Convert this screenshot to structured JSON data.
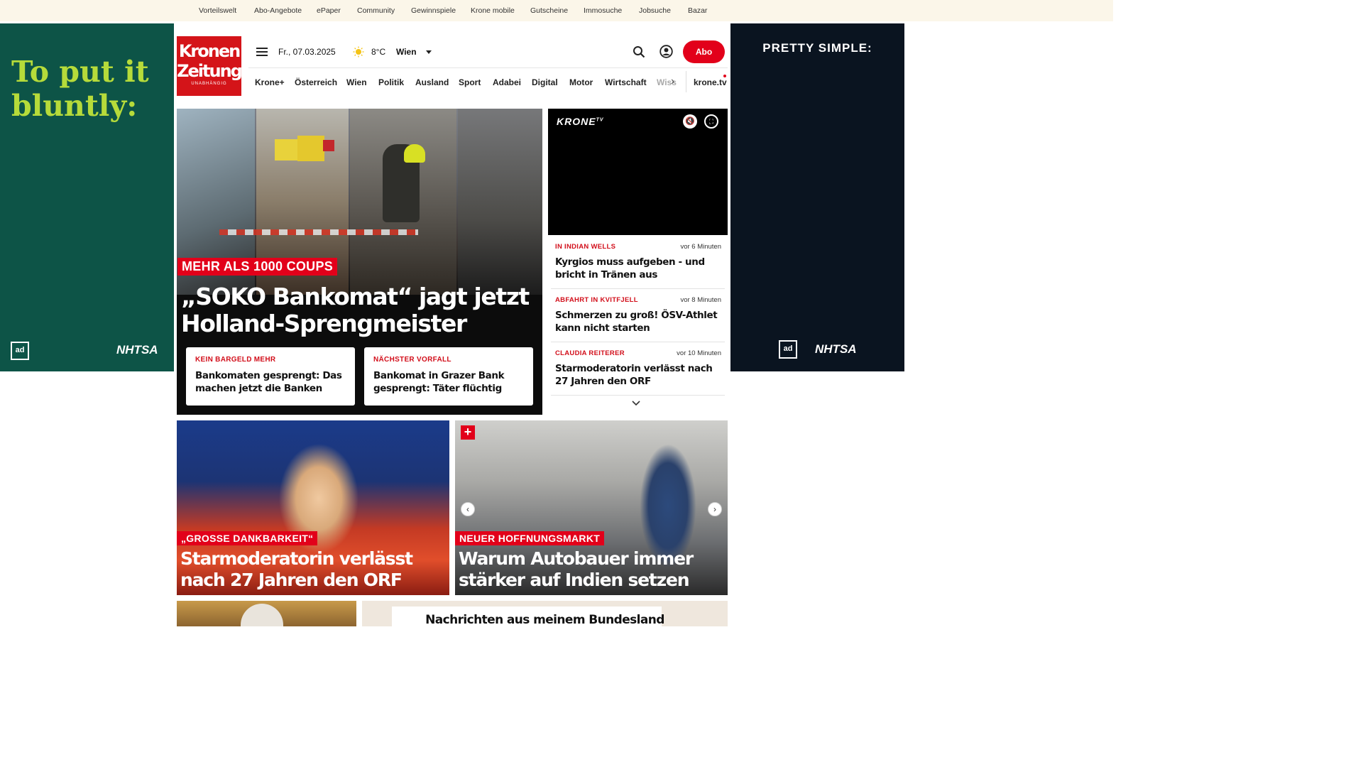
{
  "topnav": [
    "Vorteilswelt",
    "Abo-Angebote",
    "ePaper",
    "Community",
    "Gewinnspiele",
    "Krone mobile",
    "Gutscheine",
    "Immosuche",
    "Jobsuche",
    "Bazar"
  ],
  "ads": {
    "left_slogan": "To put it bluntly:",
    "right_slogan": "PRETTY SIMPLE:",
    "adcouncil": "ad",
    "nhtsa": "NHTSA"
  },
  "logo": {
    "line1": "Kronen Zeitung",
    "line2": "UNABHÄNGIG"
  },
  "header": {
    "date": "Fr., 07.03.2025",
    "temperature": "8°C",
    "city": "Wien",
    "abo_label": "Abo"
  },
  "nav": [
    "Krone+",
    "Österreich",
    "Wien",
    "Politik",
    "Ausland",
    "Sport",
    "Adabei",
    "Digital",
    "Motor",
    "Wirtschaft",
    "Wiss"
  ],
  "nav_tv": "krone.tv",
  "hero": {
    "kicker": "MEHR ALS 1000 COUPS",
    "title": "„SOKO Bankomat“ jagt jetzt Holland-Sprengmeister",
    "subcards": [
      {
        "kicker": "KEIN BARGELD MEHR",
        "title": "Bankomaten gesprengt: Das machen jetzt die Banken"
      },
      {
        "kicker": "NÄCHSTER VORFALL",
        "title": "Bankomat in Grazer Bank gesprengt: Täter flüchtig"
      }
    ]
  },
  "video": {
    "brand": "KRONE",
    "brand_sup": "TV"
  },
  "news": [
    {
      "kicker": "IN INDIAN WELLS",
      "time": "vor 6 Minuten",
      "title": "Kyrgios muss aufgeben - und bricht in Tränen aus"
    },
    {
      "kicker": "ABFAHRT IN KVITFJELL",
      "time": "vor 8 Minuten",
      "title": "Schmerzen zu groß! ÖSV-Athlet kann nicht starten"
    },
    {
      "kicker": "CLAUDIA REITERER",
      "time": "vor 10 Minuten",
      "title": "Starmoderatorin verlässt nach 27 Jahren den ORF"
    }
  ],
  "cards": [
    {
      "kicker": "„GROSSE DANKBARKEIT“",
      "title": "Starmoderatorin verlässt nach 27 Jahren den ORF"
    },
    {
      "kicker": "NEUER HOFFNUNGSMARKT",
      "title": "Warum Autobauer immer stärker auf Indien setzen"
    }
  ],
  "bundesland_title": "Nachrichten aus meinem Bundesland"
}
